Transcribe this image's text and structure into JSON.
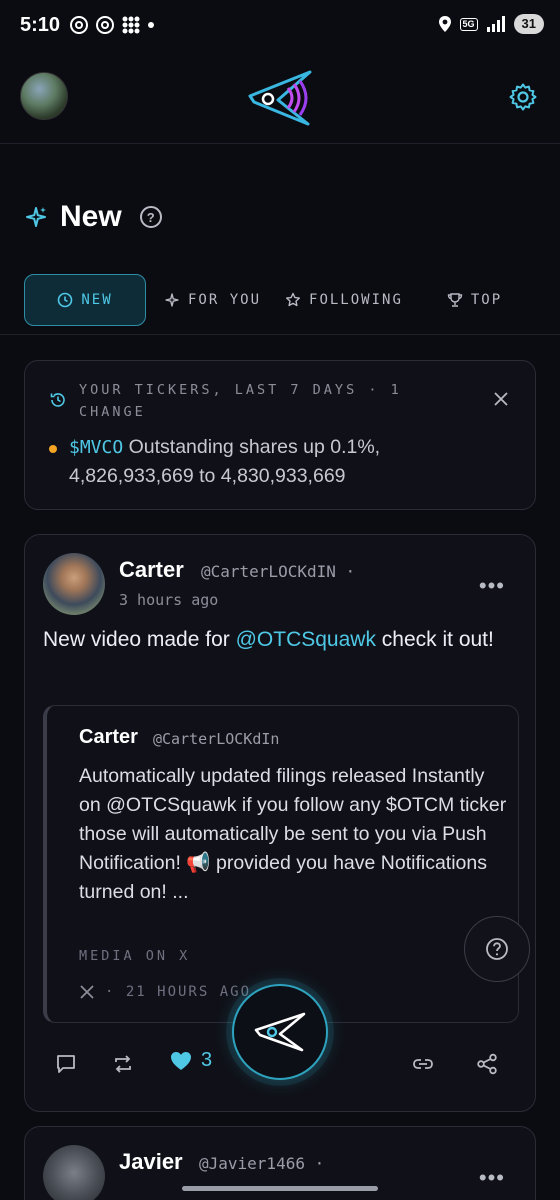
{
  "status_bar": {
    "time": "5:10",
    "network": "5G",
    "battery": "31"
  },
  "header": {
    "avatar_icon": "profile-photo",
    "logo_icon": "otcsquawk-logo",
    "settings_icon": "gear-icon"
  },
  "page": {
    "title": "New",
    "help_glyph": "?"
  },
  "tabs": [
    {
      "label": "NEW",
      "icon": "clock-icon",
      "active": true
    },
    {
      "label": "FOR YOU",
      "icon": "sparkle-icon",
      "active": false
    },
    {
      "label": "FOLLOWING",
      "icon": "star-icon",
      "active": false
    },
    {
      "label": "TOP",
      "icon": "trophy-icon",
      "active": false
    }
  ],
  "ticker_card": {
    "heading": "YOUR TICKERS, LAST 7 DAYS · 1 CHANGE",
    "symbol": "$MVCO",
    "change_text": " Outstanding shares up 0.1%, 4,826,933,669 to 4,830,933,669",
    "dot_color": "#f5a524"
  },
  "post": {
    "name": "Carter",
    "handle": "@CarterLOCKdIN",
    "separator": "·",
    "time": "3 hours ago",
    "more": "•••",
    "text_before": "New video made for ",
    "mention": "@OTCSquawk",
    "text_after": " check it out!",
    "quote": {
      "name": "Carter",
      "handle": "@CarterLOCKdIn",
      "text": "Automatically updated filings released Instantly on @OTCSquawk if you follow any $OTCM ticker those will automatically be sent to you via Push Notification! 📢 provided you have Notifications turned on! ...",
      "media_label": "MEDIA ON X",
      "source_icon": "x-logo-icon",
      "meta": "· 21 HOURS AGO"
    },
    "likes": "3"
  },
  "next_post": {
    "name": "Javier",
    "handle": "@Javier1466",
    "separator": "·",
    "more": "•••"
  },
  "colors": {
    "accent": "#4fc8e6",
    "background": "#0b0c12",
    "card": "#101118"
  }
}
